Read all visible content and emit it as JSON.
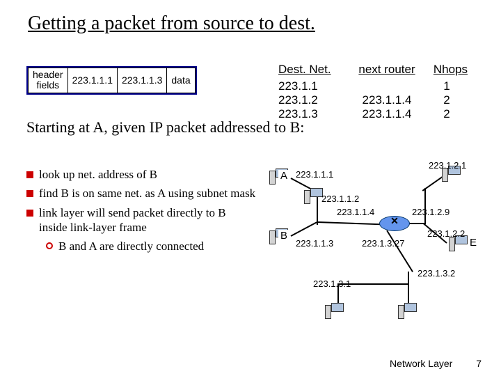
{
  "title": "Getting a packet from source to dest.",
  "packet": {
    "header_fields": "header\nfields",
    "src": "223.1.1.1",
    "dst": "223.1.1.3",
    "data": "data"
  },
  "subtitle": "Starting at A, given IP packet addressed to B:",
  "bullets": [
    "look up net. address of B",
    "find B is on same net. as A using subnet mask",
    "link layer will send packet directly to B inside link-layer frame"
  ],
  "sub_bullet": "B and A are directly connected",
  "table": {
    "headers": [
      "Dest. Net.",
      "next router",
      "Nhops"
    ],
    "rows": [
      {
        "dest": "223.1.1",
        "next": "",
        "hops": "1"
      },
      {
        "dest": "223.1.2",
        "next": "223.1.1.4",
        "hops": "2"
      },
      {
        "dest": "223.1.3",
        "next": "223.1.1.4",
        "hops": "2"
      }
    ]
  },
  "nodes": {
    "A": "A",
    "B": "B",
    "E": "E",
    "ip_111": "223.1.1.1",
    "ip_112": "223.1.1.2",
    "ip_113": "223.1.1.3",
    "ip_114": "223.1.1.4",
    "ip_121": "223.1.2.1",
    "ip_122": "223.1.2.2",
    "ip_129": "223.1.2.9",
    "ip_131": "223.1.3.1",
    "ip_132": "223.1.3.2",
    "ip_1327": "223.1.3.27"
  },
  "footer": {
    "label": "Network Layer",
    "page": "7"
  }
}
